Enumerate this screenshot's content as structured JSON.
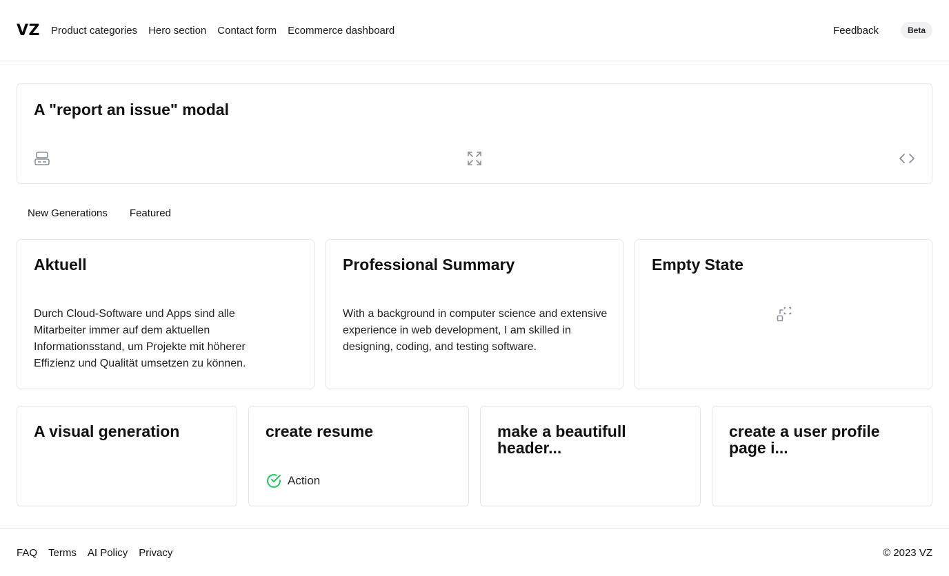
{
  "header": {
    "logo": "VZ",
    "nav": [
      "Product categories",
      "Hero section",
      "Contact form",
      "Ecommerce dashboard"
    ],
    "feedback": "Feedback",
    "badge": "Beta"
  },
  "featured_prompt": {
    "title": "A \"report an issue\" modal",
    "icons": [
      "layout-icon",
      "expand-icon",
      "code-icon"
    ]
  },
  "tabs": [
    "New Generations",
    "Featured"
  ],
  "cards_row1": [
    {
      "title": "Aktuell",
      "body": "Durch Cloud-Software und Apps sind alle Mitarbeiter immer auf dem aktuellen Informationsstand, um Projekte mit höherer Effizienz und Qualität umsetzen zu können."
    },
    {
      "title": "Professional Summary",
      "body": "With a background in computer science and extensive experience in web development, I am skilled in designing, coding, and testing software."
    },
    {
      "title": "Empty State",
      "icon": "empty-state-icon"
    }
  ],
  "cards_row2": [
    {
      "title": "A visual generation"
    },
    {
      "title": "create resume",
      "action_label": "Action",
      "action_icon": "check-circle-icon"
    },
    {
      "title": "make a beautifull header..."
    },
    {
      "title": "create a user profile page i..."
    }
  ],
  "footer": {
    "links": [
      "FAQ",
      "Terms",
      "AI Policy",
      "Privacy"
    ],
    "copyright": "© 2023 VZ"
  },
  "colors": {
    "border": "#e5e5e5",
    "icon_gray": "#8a8f99",
    "success_green": "#22c55e",
    "badge_bg": "#f1f1f3"
  }
}
